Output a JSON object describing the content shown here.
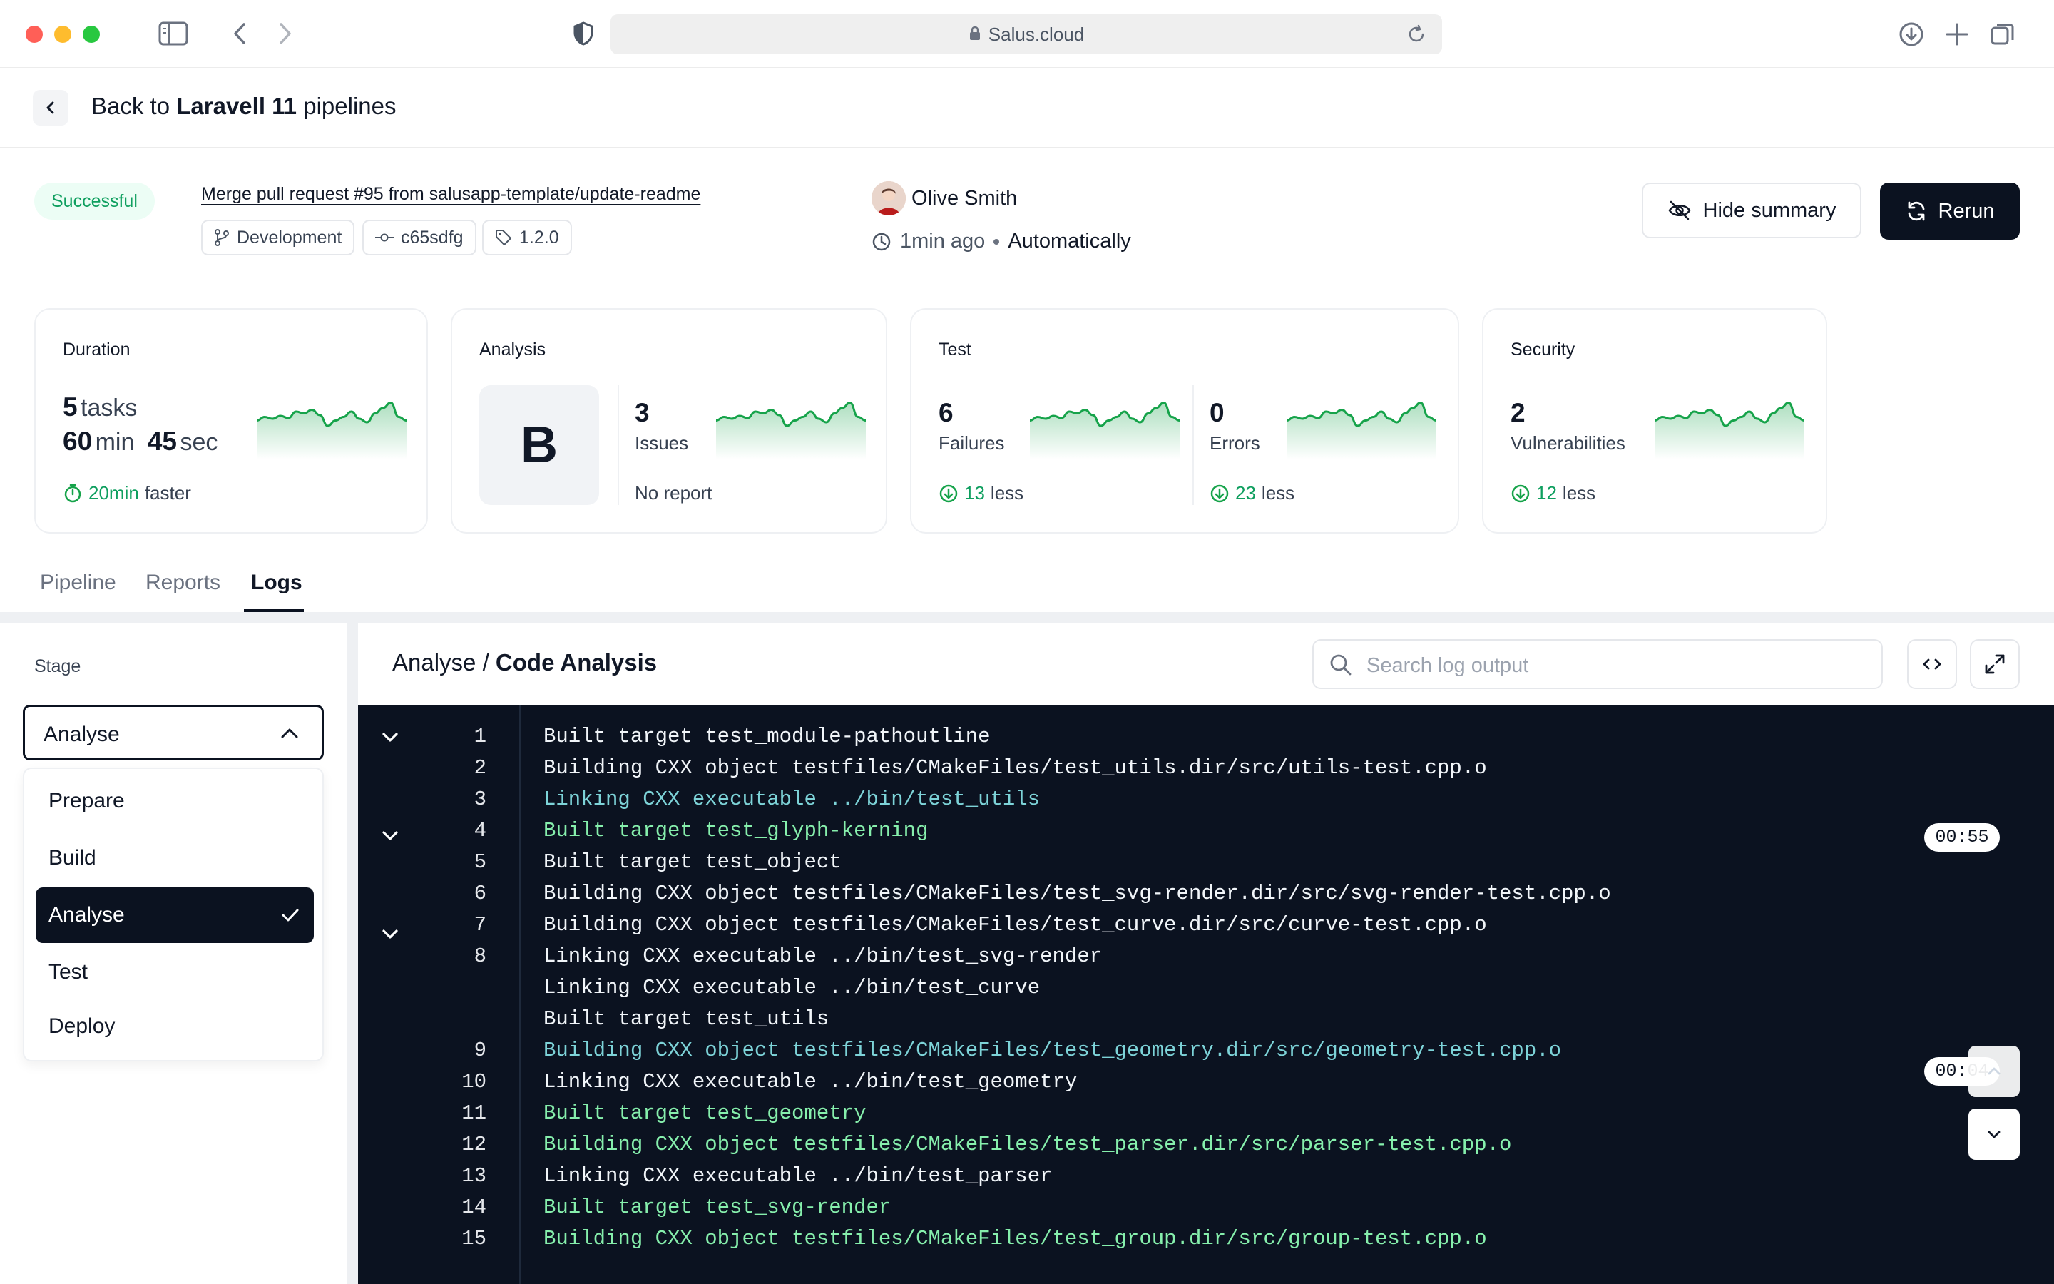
{
  "browser": {
    "url": "Salus.cloud",
    "traffic_colors": {
      "close": "#ff5f57",
      "minimize": "#febc2e",
      "maximize": "#28c840"
    }
  },
  "header": {
    "back_prefix": "Back to ",
    "back_project": "Laravell 11",
    "back_suffix": " pipelines"
  },
  "run": {
    "status": "Successful",
    "commit_message": "Merge pull request #95 from salusapp-template/update-readme",
    "branch": "Development",
    "commit": "c65sdfg",
    "tag": "1.2.0",
    "author": "Olive Smith",
    "time": "1min ago",
    "trigger": "Automatically",
    "hide_summary_label": "Hide summary",
    "rerun_label": "Rerun"
  },
  "metrics": {
    "duration": {
      "title": "Duration",
      "tasks_value": "5",
      "tasks_label": "tasks",
      "min_value": "60",
      "min_label": "min",
      "sec_value": "45",
      "sec_label": "sec",
      "delta_value": "20min",
      "delta_label": "faster"
    },
    "analysis": {
      "title": "Analysis",
      "grade": "B",
      "issues_value": "3",
      "issues_label": "Issues",
      "note": "No report"
    },
    "test": {
      "title": "Test",
      "failures_value": "6",
      "failures_label": "Failures",
      "failures_delta": "13",
      "errors_value": "0",
      "errors_label": "Errors",
      "errors_delta": "23",
      "less_label": "less"
    },
    "security": {
      "title": "Security",
      "vuln_value": "2",
      "vuln_label": "Vulnerabilities",
      "delta": "12",
      "less_label": "less"
    },
    "accent_color": "#16a34a"
  },
  "tabs": [
    {
      "label": "Pipeline",
      "active": false
    },
    {
      "label": "Reports",
      "active": false
    },
    {
      "label": "Logs",
      "active": true
    }
  ],
  "stage": {
    "label": "Stage",
    "selected": "Analyse",
    "options": [
      "Prepare",
      "Build",
      "Analyse",
      "Test",
      "Deploy"
    ]
  },
  "logs": {
    "title_prefix": "Analyse / ",
    "title_bold": "Code Analysis",
    "search_placeholder": "Search log output",
    "timestamps": [
      "00:55",
      "00:04"
    ],
    "lines": [
      {
        "num": "1",
        "text": "Built target test_module-pathoutline",
        "color": "white"
      },
      {
        "num": "2",
        "text": "Building CXX object testfiles/CMakeFiles/test_utils.dir/src/utils-test.cpp.o",
        "color": "white"
      },
      {
        "num": "3",
        "text": "Linking CXX executable ../bin/test_utils",
        "color": "cyan"
      },
      {
        "num": "4",
        "text": "Built target test_glyph-kerning",
        "color": "green"
      },
      {
        "num": "5",
        "text": "Built target test_object",
        "color": "white"
      },
      {
        "num": "6",
        "text": "Building CXX object testfiles/CMakeFiles/test_svg-render.dir/src/svg-render-test.cpp.o",
        "color": "white"
      },
      {
        "num": "7",
        "text": "Building CXX object testfiles/CMakeFiles/test_curve.dir/src/curve-test.cpp.o",
        "color": "white"
      },
      {
        "num": "8",
        "text": "Linking CXX executable ../bin/test_svg-render",
        "color": "white"
      },
      {
        "num": "",
        "text": "Linking CXX executable ../bin/test_curve",
        "color": "white"
      },
      {
        "num": "",
        "text": "Built target test_utils",
        "color": "white"
      },
      {
        "num": "9",
        "text": "Building CXX object testfiles/CMakeFiles/test_geometry.dir/src/geometry-test.cpp.o",
        "color": "cyan"
      },
      {
        "num": "10",
        "text": "Linking CXX executable ../bin/test_geometry",
        "color": "white"
      },
      {
        "num": "11",
        "text": "Built target test_geometry",
        "color": "green"
      },
      {
        "num": "12",
        "text": "Building CXX object testfiles/CMakeFiles/test_parser.dir/src/parser-test.cpp.o",
        "color": "green"
      },
      {
        "num": "13",
        "text": "Linking CXX executable ../bin/test_parser",
        "color": "white"
      },
      {
        "num": "14",
        "text": "Built target test_svg-render",
        "color": "green"
      },
      {
        "num": "15",
        "text": "Building CXX object testfiles/CMakeFiles/test_group.dir/src/group-test.cpp.o",
        "color": "green"
      }
    ]
  }
}
